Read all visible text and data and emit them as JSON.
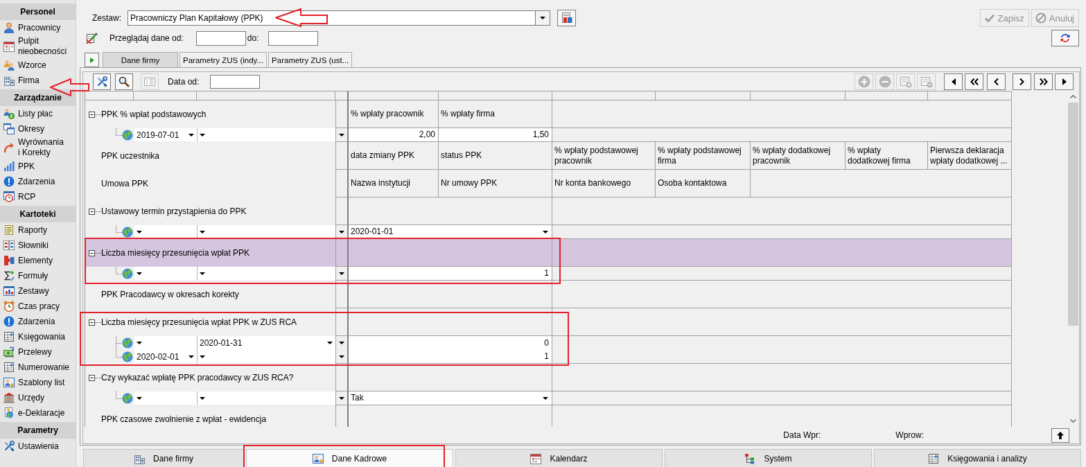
{
  "sidebar": {
    "sections": [
      {
        "title": "Personel",
        "items": [
          {
            "label": "Pracownicy",
            "selected": false
          },
          {
            "label": "Pulpit nieobecności",
            "selected": false
          },
          {
            "label": "Wzorce",
            "selected": false
          },
          {
            "label": "Firma",
            "selected": false
          }
        ]
      },
      {
        "title": "Zarządzanie",
        "items": [
          {
            "label": "Listy płac",
            "selected": false
          },
          {
            "label": "Okresy",
            "selected": false
          },
          {
            "label": "Wyrównania\ni Korekty",
            "selected": false
          },
          {
            "label": "PPK",
            "selected": false
          },
          {
            "label": "Zdarzenia",
            "selected": false
          },
          {
            "label": "RCP",
            "selected": false
          }
        ]
      },
      {
        "title": "Kartoteki",
        "items": [
          {
            "label": "Raporty",
            "selected": false
          },
          {
            "label": "Słowniki",
            "selected": false
          },
          {
            "label": "Elementy",
            "selected": false
          },
          {
            "label": "Formuły",
            "selected": false
          },
          {
            "label": "Zestawy",
            "selected": false
          },
          {
            "label": "Czas pracy",
            "selected": false
          },
          {
            "label": "Zdarzenia",
            "selected": false
          },
          {
            "label": "Księgowania",
            "selected": false
          },
          {
            "label": "Przelewy",
            "selected": false
          },
          {
            "label": "Numerowanie",
            "selected": false
          },
          {
            "label": "Szablony list",
            "selected": false
          },
          {
            "label": "Urzędy",
            "selected": false
          },
          {
            "label": "e-Deklaracje",
            "selected": false
          }
        ]
      },
      {
        "title": "Parametry",
        "items": [
          {
            "label": "Ustawienia",
            "selected": false
          }
        ]
      }
    ]
  },
  "set_selector": {
    "label": "Zestaw:",
    "value": "Pracowniczy Plan Kapitałowy (PPK)"
  },
  "actions": [
    {
      "label": "Zapisz",
      "disabled": true
    },
    {
      "label": "Anuluj",
      "disabled": true
    }
  ],
  "date_range": {
    "label": "Przeglądaj dane od:",
    "to_label": "do:"
  },
  "tabs": [
    {
      "label": "Dane firmy",
      "selected": true
    },
    {
      "label": "Parametry ZUS (indy...",
      "selected": false
    },
    {
      "label": "Parametry ZUS (ust...",
      "selected": false
    }
  ],
  "panel": {
    "toolbar": {
      "tool_buttons": [
        {
          "disabled": false
        },
        {
          "disabled": false
        },
        {
          "disabled": true
        }
      ],
      "date_label": "Data od:",
      "record_buttons": [
        {
          "disabled": true
        },
        {
          "disabled": true
        },
        {
          "disabled": true
        },
        {
          "disabled": true
        }
      ],
      "nav_buttons": [
        {
          "disabled": false
        },
        {
          "disabled": false
        },
        {
          "disabled": false
        },
        {
          "disabled": false
        },
        {
          "disabled": false
        },
        {
          "disabled": false
        }
      ]
    },
    "grid": {
      "rows": [
        {
          "kind": "group",
          "label": "PPK % wpłat podstawowych",
          "expanded": true,
          "selected": false,
          "cells": [
            "% wpłaty pracownik",
            "% wpłaty firma"
          ]
        },
        {
          "kind": "entry",
          "selected": false,
          "column_1": "2019-07-01",
          "values": [
            {
              "kind": "number",
              "text": "2,00"
            },
            {
              "kind": "number",
              "text": "1,50"
            }
          ]
        },
        {
          "kind": "label",
          "label": "PPK uczestnika",
          "selected": false,
          "cells": [
            "data zmiany PPK",
            "status PPK",
            "% wpłaty podstawowej pracownik",
            "% wpłaty podstawowej firma",
            "% wpłaty dodatkowej pracownik",
            "% wpłaty dodatkowej firma",
            "Pierwsza deklaracja wpłaty dodatkowej ..."
          ]
        },
        {
          "kind": "label",
          "label": "Umowa PPK",
          "selected": false,
          "cells": [
            "Nazwa instytucji",
            "Nr umowy PPK",
            "Nr konta bankowego",
            "Osoba kontaktowa"
          ]
        },
        {
          "kind": "group",
          "label": "Ustawowy termin przystąpienia do PPK",
          "expanded": true,
          "selected": false
        },
        {
          "kind": "entry",
          "selected": false,
          "values": [
            {
              "kind": "select",
              "text": "2020-01-01"
            }
          ]
        },
        {
          "kind": "group",
          "label": "Liczba miesięcy przesunięcia wpłat PPK",
          "expanded": true,
          "selected": true
        },
        {
          "kind": "entry",
          "selected": false,
          "values": [
            {
              "kind": "number",
              "text": "1"
            }
          ]
        },
        {
          "kind": "label",
          "label": "PPK Pracodawcy w okresach korekty",
          "selected": false
        },
        {
          "kind": "group",
          "label": "Liczba miesięcy przesunięcia wpłat PPK w ZUS RCA",
          "expanded": true,
          "selected": false
        },
        {
          "kind": "entry",
          "selected": false,
          "column_2": "2020-01-31",
          "values": [
            {
              "kind": "number",
              "text": "0"
            }
          ]
        },
        {
          "kind": "entry",
          "selected": false,
          "column_1": "2020-02-01",
          "values": [
            {
              "kind": "number",
              "text": "1"
            }
          ]
        },
        {
          "kind": "group",
          "label": "Czy wykazać wpłatę PPK pracodawcy w ZUS RCA?",
          "expanded": true,
          "selected": false
        },
        {
          "kind": "entry",
          "selected": false,
          "values": [
            {
              "kind": "select",
              "text": "Tak"
            }
          ]
        },
        {
          "kind": "label",
          "label": "PPK czasowe zwolnienie z wpłat - ewidencja",
          "selected": false
        }
      ]
    },
    "footer": {
      "entry_date_label": "Data Wpr:",
      "entered_by_label": "Wprow:"
    }
  },
  "bottom_tabs": [
    {
      "label": "Dane firmy",
      "selected": false
    },
    {
      "label": "Dane Kadrowe",
      "selected": true
    },
    {
      "label": "Kalendarz",
      "selected": false
    },
    {
      "label": "System",
      "selected": false
    },
    {
      "label": "Księgowania i analizy",
      "selected": false
    }
  ]
}
